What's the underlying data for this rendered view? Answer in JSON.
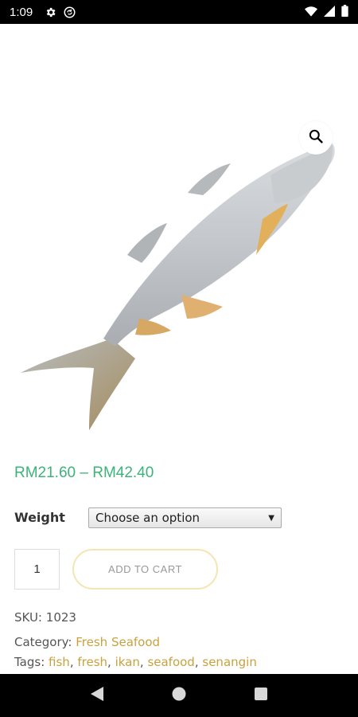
{
  "status_bar": {
    "time": "1:09"
  },
  "product": {
    "price": "RM21.60 – RM42.40",
    "weight_label": "Weight",
    "weight_select_value": "Choose an option",
    "quantity": "1",
    "add_to_cart_label": "ADD TO CART",
    "sku_label": "SKU:",
    "sku_value": "1023",
    "category_label": "Category:",
    "category_value": "Fresh Seafood",
    "tags_label": "Tags:",
    "tags": [
      "fish",
      "fresh",
      "ikan",
      "seafood",
      "senangin"
    ]
  },
  "colors": {
    "price": "#3db37b",
    "link": "#c9a23f",
    "cart_border": "#f3e6b3"
  }
}
